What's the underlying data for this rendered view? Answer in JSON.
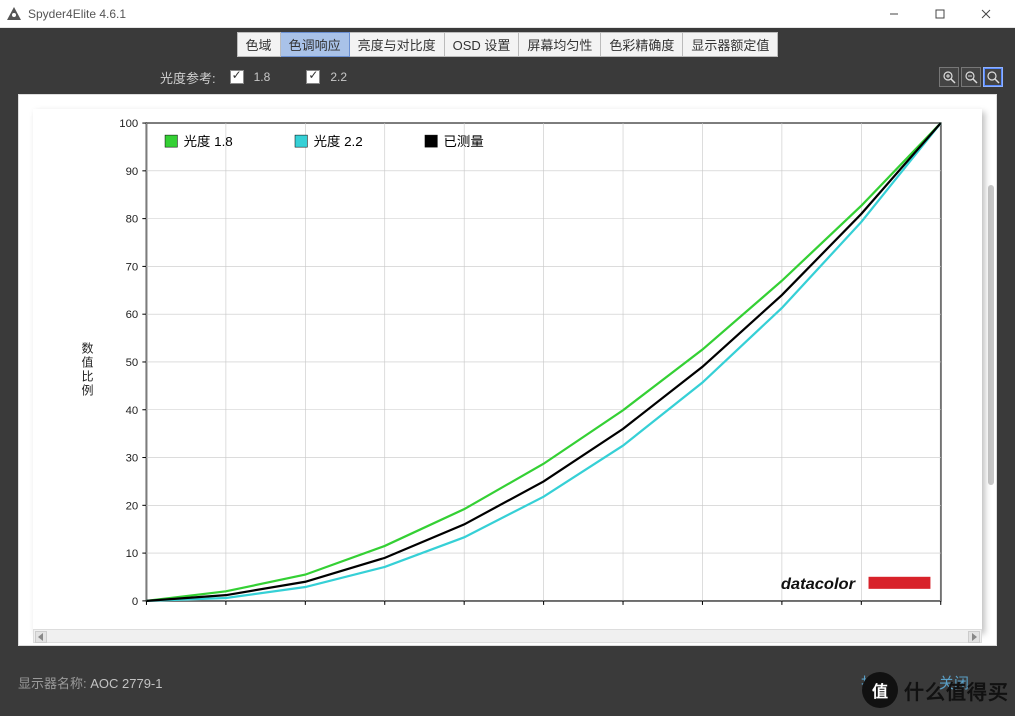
{
  "window": {
    "title": "Spyder4Elite 4.6.1"
  },
  "tabs": [
    "色域",
    "色调响应",
    "亮度与对比度",
    "OSD 设置",
    "屏幕均匀性",
    "色彩精确度",
    "显示器额定值"
  ],
  "active_tab_index": 1,
  "options": {
    "label": "光度参考:",
    "opt1_label": "1.8",
    "opt2_label": "2.2",
    "opt1_checked": true,
    "opt2_checked": true
  },
  "chart_data": {
    "type": "line",
    "ylabel": "数值比例",
    "xlabel": "",
    "xlim": [
      0,
      100
    ],
    "ylim": [
      0,
      100
    ],
    "x": [
      0,
      10,
      20,
      30,
      40,
      50,
      60,
      70,
      80,
      90,
      100
    ],
    "series": [
      {
        "name": "光度 1.8",
        "color": "#34d034",
        "values": [
          0,
          2.0,
          5.5,
          11.5,
          19.2,
          28.7,
          39.9,
          52.6,
          67.0,
          82.7,
          100
        ]
      },
      {
        "name": "光度 2.2",
        "color": "#36d0d6",
        "values": [
          0,
          0.6,
          2.9,
          7.1,
          13.3,
          21.8,
          32.5,
          45.7,
          61.3,
          79.3,
          100
        ]
      },
      {
        "name": "已测量",
        "color": "#000000",
        "values": [
          0,
          1.2,
          4.0,
          9.0,
          16.0,
          25.0,
          36.0,
          49.0,
          64.0,
          81.0,
          100
        ]
      }
    ],
    "legend": [
      "光度 1.8",
      "光度 2.2",
      "已测量"
    ],
    "y_ticks": [
      0,
      10,
      20,
      30,
      40,
      50,
      60,
      70,
      80,
      90,
      100
    ],
    "brand": "datacolor"
  },
  "bottom": {
    "label": "显示器名称: ",
    "display_name": "AOC 2779-1",
    "print": "打印",
    "close": "关闭"
  },
  "watermark": {
    "badge": "值",
    "text": "什么值得买"
  }
}
